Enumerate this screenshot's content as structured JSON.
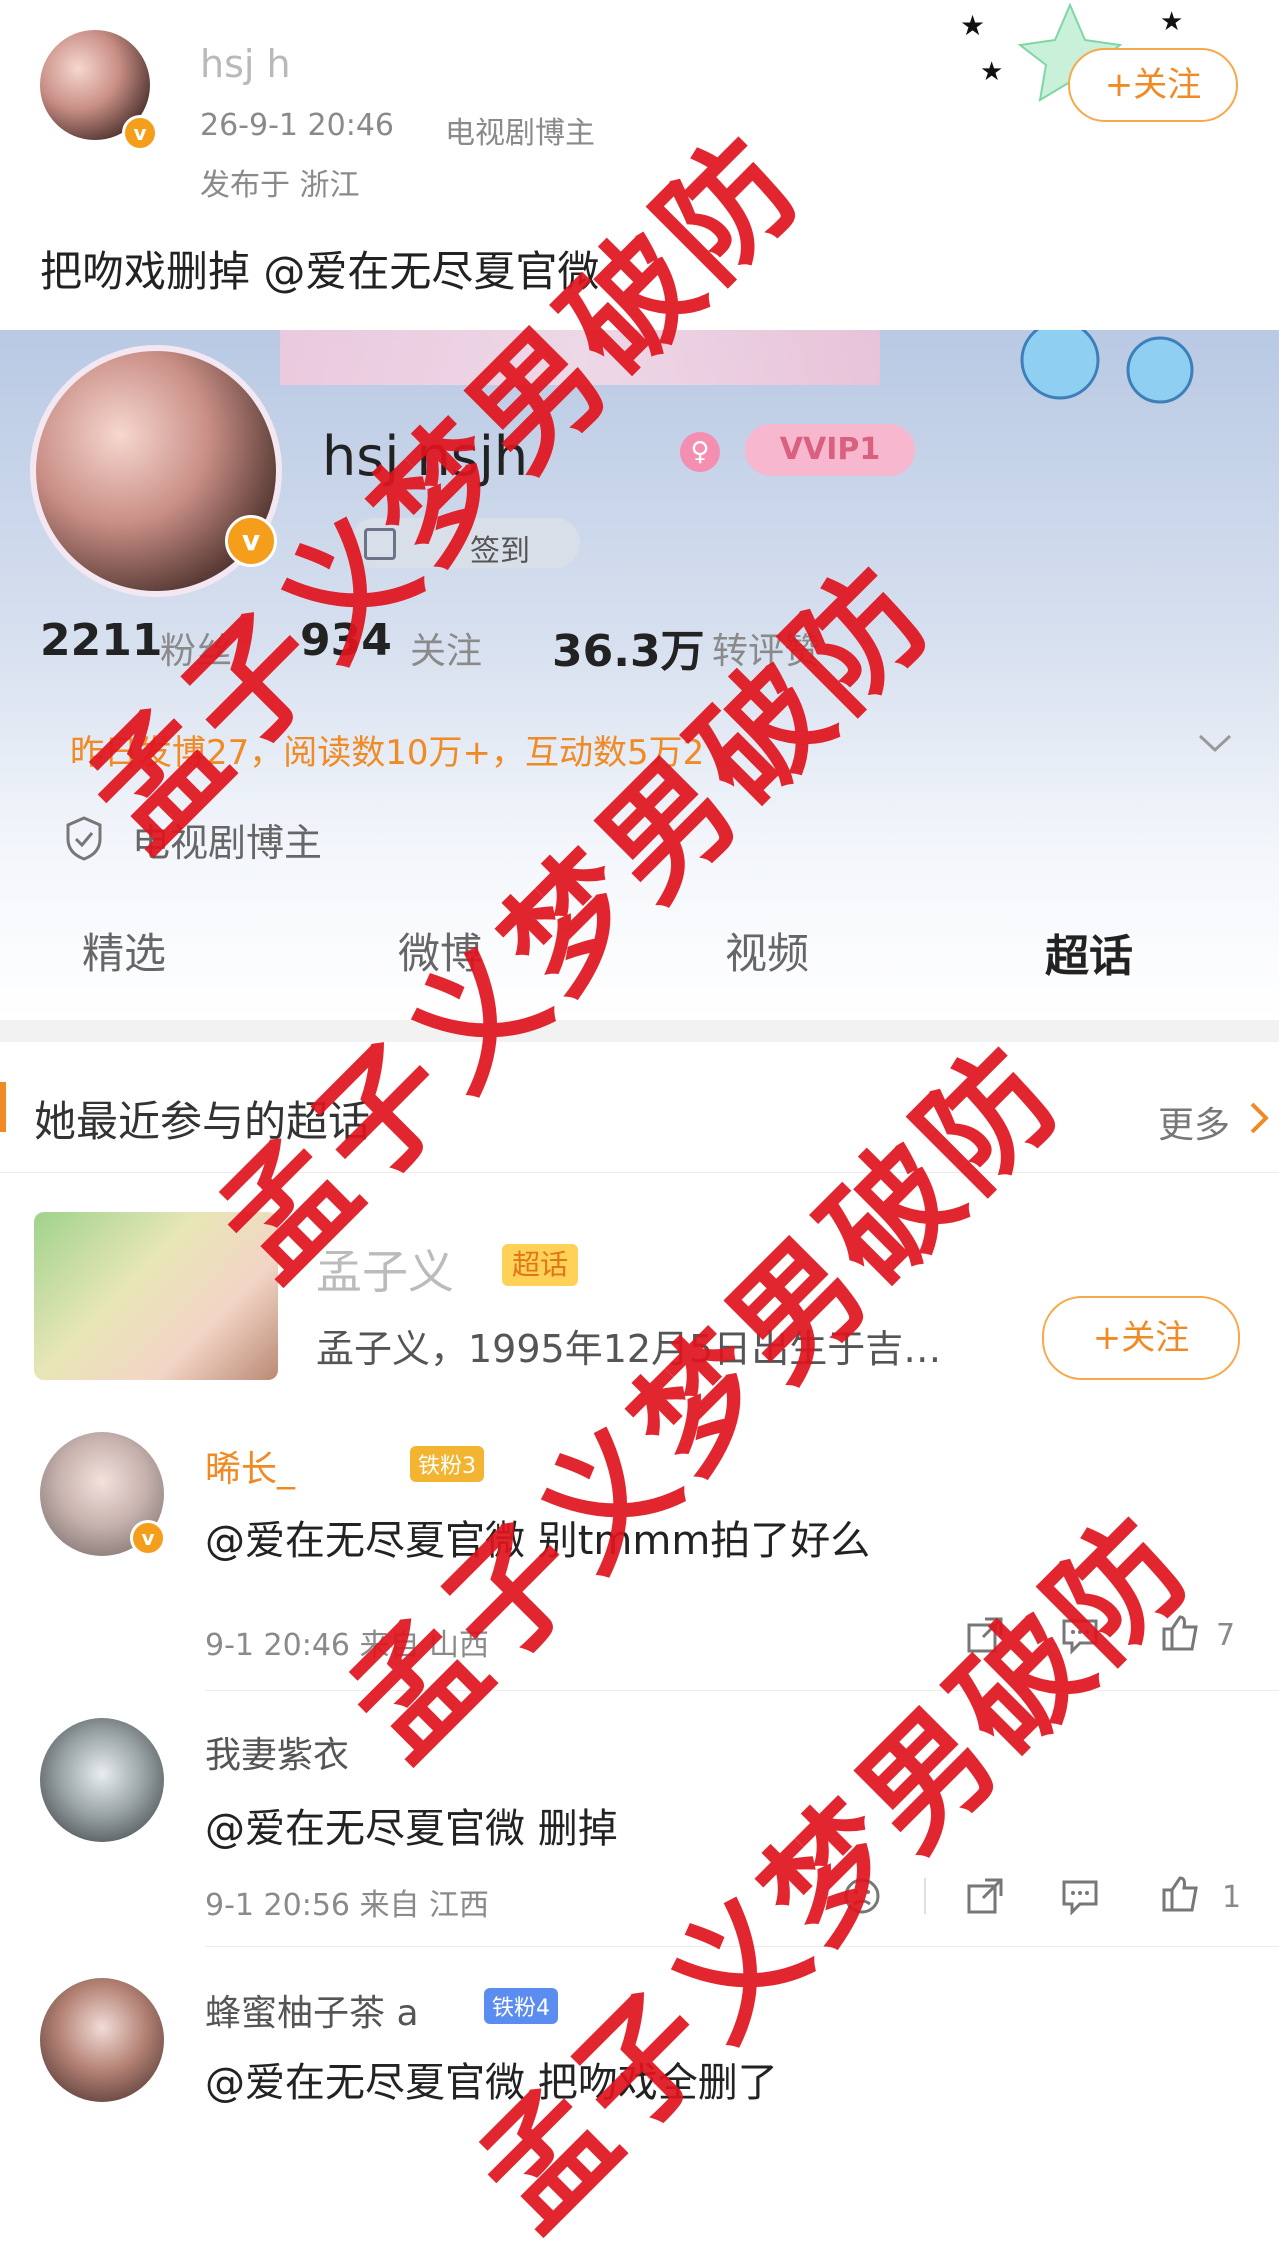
{
  "post": {
    "author": "hsj  h",
    "time": "26-9-1 20:46",
    "author_tag": "电视剧博主",
    "location": "发布于 浙江",
    "follow_label": "+关注",
    "text": "把吻戏删掉 @爱在无尽夏官微"
  },
  "profile": {
    "name": "hsj   nsjh",
    "vip_badge": "VVIP1",
    "checkin": "签到",
    "stats": {
      "fans_value": "2211",
      "fans_label": "粉丝",
      "follow_value": "934",
      "follow_label": "关注",
      "likes_value": "36.3万",
      "likes_label": "转评赞"
    },
    "summary": "昨日发博27，阅读数10万+，互动数5万2",
    "role": "电视剧博主"
  },
  "tabs": [
    "精选",
    "微博",
    "视频",
    "超话"
  ],
  "supertopic": {
    "header": "她最近参与的超话",
    "more": "更多",
    "name": "孟子义",
    "badge": "超话",
    "desc": "孟子义，1995年12月5日出生于吉…",
    "follow_label": "+关注"
  },
  "comments": [
    {
      "user": "  晞长_",
      "badge": "铁粉3",
      "text": "@爱在无尽夏官微 别tmmm拍了好么",
      "meta": "9-1 20:46 来自 山西",
      "likes": "7"
    },
    {
      "user": "我妻紫衣",
      "badge": "",
      "text": "@爱在无尽夏官微 删掉",
      "meta": "9-1 20:56 来自 江西",
      "likes": "1"
    },
    {
      "user": "蜂蜜柚子茶  a",
      "badge": "铁粉4",
      "text": "@爱在无尽夏官微 把吻戏全删了",
      "meta": "",
      "likes": ""
    }
  ],
  "watermark": "孟子义梦男破防",
  "colors": {
    "accent": "#f08a24",
    "watermark": "#e0141e",
    "badge_blue": "#5b8cf0"
  }
}
